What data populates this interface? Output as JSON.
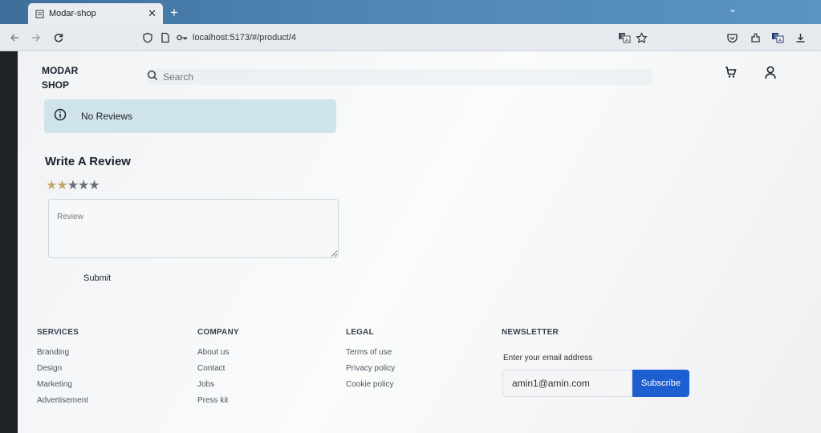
{
  "browser": {
    "tab_title": "Modar-shop",
    "url": "localhost:5173/#/product/4"
  },
  "header": {
    "logo_line1": "MODAR",
    "logo_line2": "SHOP",
    "search_placeholder": "Search"
  },
  "reviews": {
    "empty_message": "No Reviews",
    "write_title": "Write A Review",
    "rating": 2,
    "rating_max": 5,
    "review_placeholder": "Review",
    "submit_label": "Submit"
  },
  "footer": {
    "services": {
      "heading": "SERVICES",
      "links": [
        "Branding",
        "Design",
        "Marketing",
        "Advertisement"
      ]
    },
    "company": {
      "heading": "COMPANY",
      "links": [
        "About us",
        "Contact",
        "Jobs",
        "Press kit"
      ]
    },
    "legal": {
      "heading": "LEGAL",
      "links": [
        "Terms of use",
        "Privacy policy",
        "Cookie policy"
      ]
    },
    "newsletter": {
      "heading": "NEWSLETTER",
      "label": "Enter your email address",
      "email_value": "amin1@amin.com",
      "button_label": "Subscribe"
    }
  },
  "colors": {
    "accent": "#1d5fd0",
    "alert_bg": "#cfe3ec",
    "star_on": "#c6a76b",
    "star_off": "#6a6f78"
  }
}
